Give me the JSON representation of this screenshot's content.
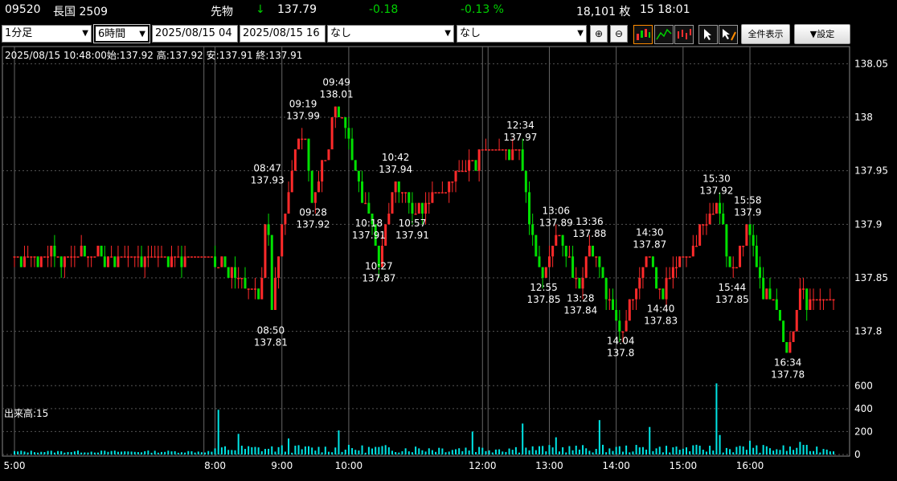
{
  "header": {
    "code": "09520",
    "name": "長国 2509",
    "type": "先物",
    "arrow": "↓",
    "price": "137.79",
    "change": "-0.18",
    "change_pct": "-0.13 %",
    "volume": "18,101 枚",
    "time": "15 18:01"
  },
  "toolbar": {
    "interval": "1分足",
    "span": "6時間",
    "date_from": "2025/08/15 04",
    "date_to": "2025/08/15 16",
    "indicator1": "なし",
    "indicator2": "なし",
    "show_all_label": "全件表示",
    "settings_label": "▼設定"
  },
  "colors": {
    "up": "#ff2a2a",
    "down": "#00e000",
    "volume": "#00e5e5",
    "grid": "#555555",
    "change": "#00d000"
  },
  "chart_data": {
    "type": "candlestick",
    "info_line": "2025/08/15 10:48:00始:137.92 高:137.92 安:137.91 終:137.91",
    "volume_label": "出来高:15",
    "y_ticks": [
      "138.05",
      "138",
      "137.95",
      "137.9",
      "137.85",
      "137.8"
    ],
    "volume_ticks": [
      "600",
      "400",
      "200",
      "0"
    ],
    "x_ticks": [
      "5:00",
      "8:00",
      "9:00",
      "10:00",
      "12:00",
      "13:00",
      "14:00",
      "15:00",
      "16:00"
    ],
    "ylim": [
      137.76,
      138.06
    ],
    "volume_ylim": [
      0,
      700
    ],
    "price_path": [
      {
        "t": "5:00",
        "v": 137.87
      },
      {
        "t": "7:50",
        "v": 137.87
      },
      {
        "t": "8:10",
        "v": 137.86
      },
      {
        "t": "8:40",
        "v": 137.83
      },
      {
        "t": "8:47",
        "v": 137.93
      },
      {
        "t": "8:50",
        "v": 137.81
      },
      {
        "t": "9:00",
        "v": 137.9
      },
      {
        "t": "9:10",
        "v": 137.96
      },
      {
        "t": "9:19",
        "v": 137.99
      },
      {
        "t": "9:28",
        "v": 137.92
      },
      {
        "t": "9:40",
        "v": 137.97
      },
      {
        "t": "9:49",
        "v": 138.01
      },
      {
        "t": "10:00",
        "v": 137.98
      },
      {
        "t": "10:10",
        "v": 137.93
      },
      {
        "t": "10:18",
        "v": 137.91
      },
      {
        "t": "10:27",
        "v": 137.87
      },
      {
        "t": "10:42",
        "v": 137.94
      },
      {
        "t": "10:57",
        "v": 137.91
      },
      {
        "t": "11:30",
        "v": 137.94
      },
      {
        "t": "12:05",
        "v": 137.97
      },
      {
        "t": "12:34",
        "v": 137.97
      },
      {
        "t": "12:45",
        "v": 137.88
      },
      {
        "t": "12:55",
        "v": 137.85
      },
      {
        "t": "13:06",
        "v": 137.89
      },
      {
        "t": "13:28",
        "v": 137.84
      },
      {
        "t": "13:36",
        "v": 137.88
      },
      {
        "t": "13:50",
        "v": 137.84
      },
      {
        "t": "14:04",
        "v": 137.8
      },
      {
        "t": "14:15",
        "v": 137.83
      },
      {
        "t": "14:30",
        "v": 137.87
      },
      {
        "t": "14:40",
        "v": 137.83
      },
      {
        "t": "14:55",
        "v": 137.86
      },
      {
        "t": "15:30",
        "v": 137.92
      },
      {
        "t": "15:44",
        "v": 137.85
      },
      {
        "t": "15:58",
        "v": 137.9
      },
      {
        "t": "16:10",
        "v": 137.84
      },
      {
        "t": "16:25",
        "v": 137.82
      },
      {
        "t": "16:34",
        "v": 137.78
      },
      {
        "t": "16:45",
        "v": 137.83
      },
      {
        "t": "17:15",
        "v": 137.83
      }
    ],
    "annotations": [
      {
        "time": "08:47",
        "price": "137.93",
        "pos": "above",
        "t": "8:47",
        "v": 137.93
      },
      {
        "time": "08:50",
        "price": "137.81",
        "pos": "below",
        "t": "8:50",
        "v": 137.81
      },
      {
        "time": "09:19",
        "price": "137.99",
        "pos": "above",
        "t": "9:19",
        "v": 137.99
      },
      {
        "time": "09:28",
        "price": "137.92",
        "pos": "below",
        "t": "9:28",
        "v": 137.92
      },
      {
        "time": "09:49",
        "price": "138.01",
        "pos": "above",
        "t": "9:49",
        "v": 138.01
      },
      {
        "time": "10:18",
        "price": "137.91",
        "pos": "below",
        "t": "10:18",
        "v": 137.91
      },
      {
        "time": "10:27",
        "price": "137.87",
        "pos": "below",
        "t": "10:27",
        "v": 137.87
      },
      {
        "time": "10:42",
        "price": "137.94",
        "pos": "above",
        "t": "10:42",
        "v": 137.94
      },
      {
        "time": "10:57",
        "price": "137.91",
        "pos": "below",
        "t": "10:57",
        "v": 137.91
      },
      {
        "time": "12:34",
        "price": "137.97",
        "pos": "above",
        "t": "12:34",
        "v": 137.97
      },
      {
        "time": "12:55",
        "price": "137.85",
        "pos": "below",
        "t": "12:55",
        "v": 137.85
      },
      {
        "time": "13:06",
        "price": "137.89",
        "pos": "above",
        "t": "13:06",
        "v": 137.89
      },
      {
        "time": "13:28",
        "price": "137.84",
        "pos": "below",
        "t": "13:28",
        "v": 137.84
      },
      {
        "time": "13:36",
        "price": "137.88",
        "pos": "above",
        "t": "13:36",
        "v": 137.88
      },
      {
        "time": "14:04",
        "price": "137.8",
        "pos": "below",
        "t": "14:04",
        "v": 137.8
      },
      {
        "time": "14:30",
        "price": "137.87",
        "pos": "above",
        "t": "14:30",
        "v": 137.87
      },
      {
        "time": "14:40",
        "price": "137.83",
        "pos": "below",
        "t": "14:40",
        "v": 137.83
      },
      {
        "time": "15:30",
        "price": "137.92",
        "pos": "above",
        "t": "15:30",
        "v": 137.92
      },
      {
        "time": "15:44",
        "price": "137.85",
        "pos": "below",
        "t": "15:44",
        "v": 137.85
      },
      {
        "time": "15:58",
        "price": "137.9",
        "pos": "above",
        "t": "15:58",
        "v": 137.9
      },
      {
        "time": "16:34",
        "price": "137.78",
        "pos": "below",
        "t": "16:34",
        "v": 137.78
      }
    ],
    "volume_peaks": [
      {
        "t": "8:02",
        "v": 390
      },
      {
        "t": "8:20",
        "v": 180
      },
      {
        "t": "9:05",
        "v": 140
      },
      {
        "t": "9:50",
        "v": 210
      },
      {
        "t": "11:50",
        "v": 200
      },
      {
        "t": "12:37",
        "v": 270
      },
      {
        "t": "13:05",
        "v": 150
      },
      {
        "t": "13:45",
        "v": 300
      },
      {
        "t": "14:30",
        "v": 240
      },
      {
        "t": "15:30",
        "v": 620
      },
      {
        "t": "15:34",
        "v": 170
      },
      {
        "t": "16:00",
        "v": 120
      },
      {
        "t": "16:45",
        "v": 110
      }
    ]
  }
}
